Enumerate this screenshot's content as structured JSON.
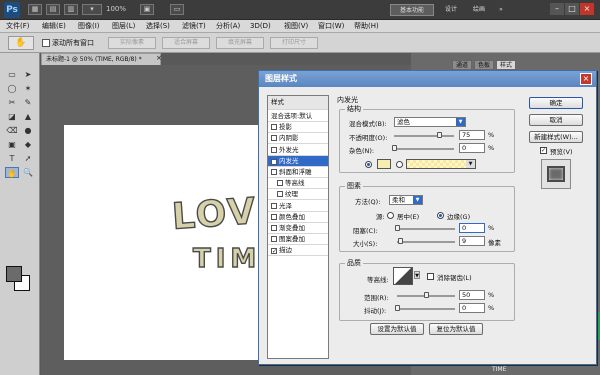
{
  "app": {
    "logo": "Ps",
    "zoom": "100%",
    "doc_tab": "未标题-1 @ 50% (TIME, RGB/8) *",
    "doc_close": "×"
  },
  "workspace": {
    "essentials": "基本功能",
    "design": "设计",
    "paint": "绘画",
    "more": "»"
  },
  "window_controls": {
    "min": "–",
    "max": "□",
    "close": "×"
  },
  "menus": [
    "文件(F)",
    "编辑(E)",
    "图像(I)",
    "图层(L)",
    "选择(S)",
    "滤镜(T)",
    "分析(A)",
    "3D(D)",
    "视图(V)",
    "窗口(W)",
    "帮助(H)"
  ],
  "options_bar": {
    "tool_icon": "✋",
    "scroll_all": "滚动所有窗口",
    "buttons": [
      "实际像素",
      "适合屏幕",
      "填充屏幕",
      "打印尺寸"
    ]
  },
  "tools": [
    "▭",
    "➤",
    "◯",
    "✶",
    "✂",
    "✎",
    "◪",
    "▲",
    "⌫",
    "●",
    "▣",
    "◆",
    "T",
    "➚",
    "✋",
    "🔍"
  ],
  "canvas_art": {
    "line1": "LOVE",
    "line2": "TIME"
  },
  "panels": {
    "tabs": [
      "通道",
      "色板",
      "样式"
    ],
    "layer_name": "TIME"
  },
  "dialog": {
    "title": "图层样式",
    "close": "×",
    "styles_header": "样式",
    "style_items": [
      {
        "label": "混合选项:默认",
        "checked": null
      },
      {
        "label": "投影",
        "checked": false
      },
      {
        "label": "内阴影",
        "checked": false
      },
      {
        "label": "外发光",
        "checked": false
      },
      {
        "label": "内发光",
        "checked": true,
        "selected": true
      },
      {
        "label": "斜面和浮雕",
        "checked": false
      },
      {
        "label": "等高线",
        "checked": false,
        "indent": true
      },
      {
        "label": "纹理",
        "checked": false,
        "indent": true
      },
      {
        "label": "光泽",
        "checked": false
      },
      {
        "label": "颜色叠加",
        "checked": false
      },
      {
        "label": "渐变叠加",
        "checked": false
      },
      {
        "label": "图案叠加",
        "checked": false
      },
      {
        "label": "描边",
        "checked": true
      }
    ],
    "section_title": "内发光",
    "structure": {
      "title": "结构",
      "blend_mode_label": "混合模式(B):",
      "blend_mode_value": "滤色",
      "opacity_label": "不透明度(O):",
      "opacity_value": "75",
      "opacity_unit": "%",
      "opacity_level": 0.75,
      "noise_label": "杂色(N):",
      "noise_value": "0",
      "noise_unit": "%",
      "noise_level": 0,
      "glow_color": "#f4eeb0"
    },
    "elements": {
      "title": "图素",
      "method_label": "方法(Q):",
      "method_value": "柔和",
      "source_label": "源:",
      "center_label": "居中(E)",
      "edge_label": "边缘(G)",
      "source_selected": "edge",
      "choke_label": "阻塞(C):",
      "choke_value": "0",
      "choke_unit": "%",
      "choke_level": 0,
      "size_label": "大小(S):",
      "size_value": "9",
      "size_unit": "像素",
      "size_level": 0.05
    },
    "quality": {
      "title": "品质",
      "contour_label": "等高线:",
      "antialias_label": "消除锯齿(L)",
      "range_label": "范围(R):",
      "range_value": "50",
      "range_unit": "%",
      "range_level": 0.5,
      "jitter_label": "抖动(J):",
      "jitter_value": "0",
      "jitter_unit": "%",
      "jitter_level": 0
    },
    "make_default": "设置为默认值",
    "reset_default": "复位为默认值",
    "ok": "确定",
    "cancel": "取消",
    "new_style": "新建样式(W)...",
    "preview_label": "预览(V)",
    "preview_checked": true
  }
}
